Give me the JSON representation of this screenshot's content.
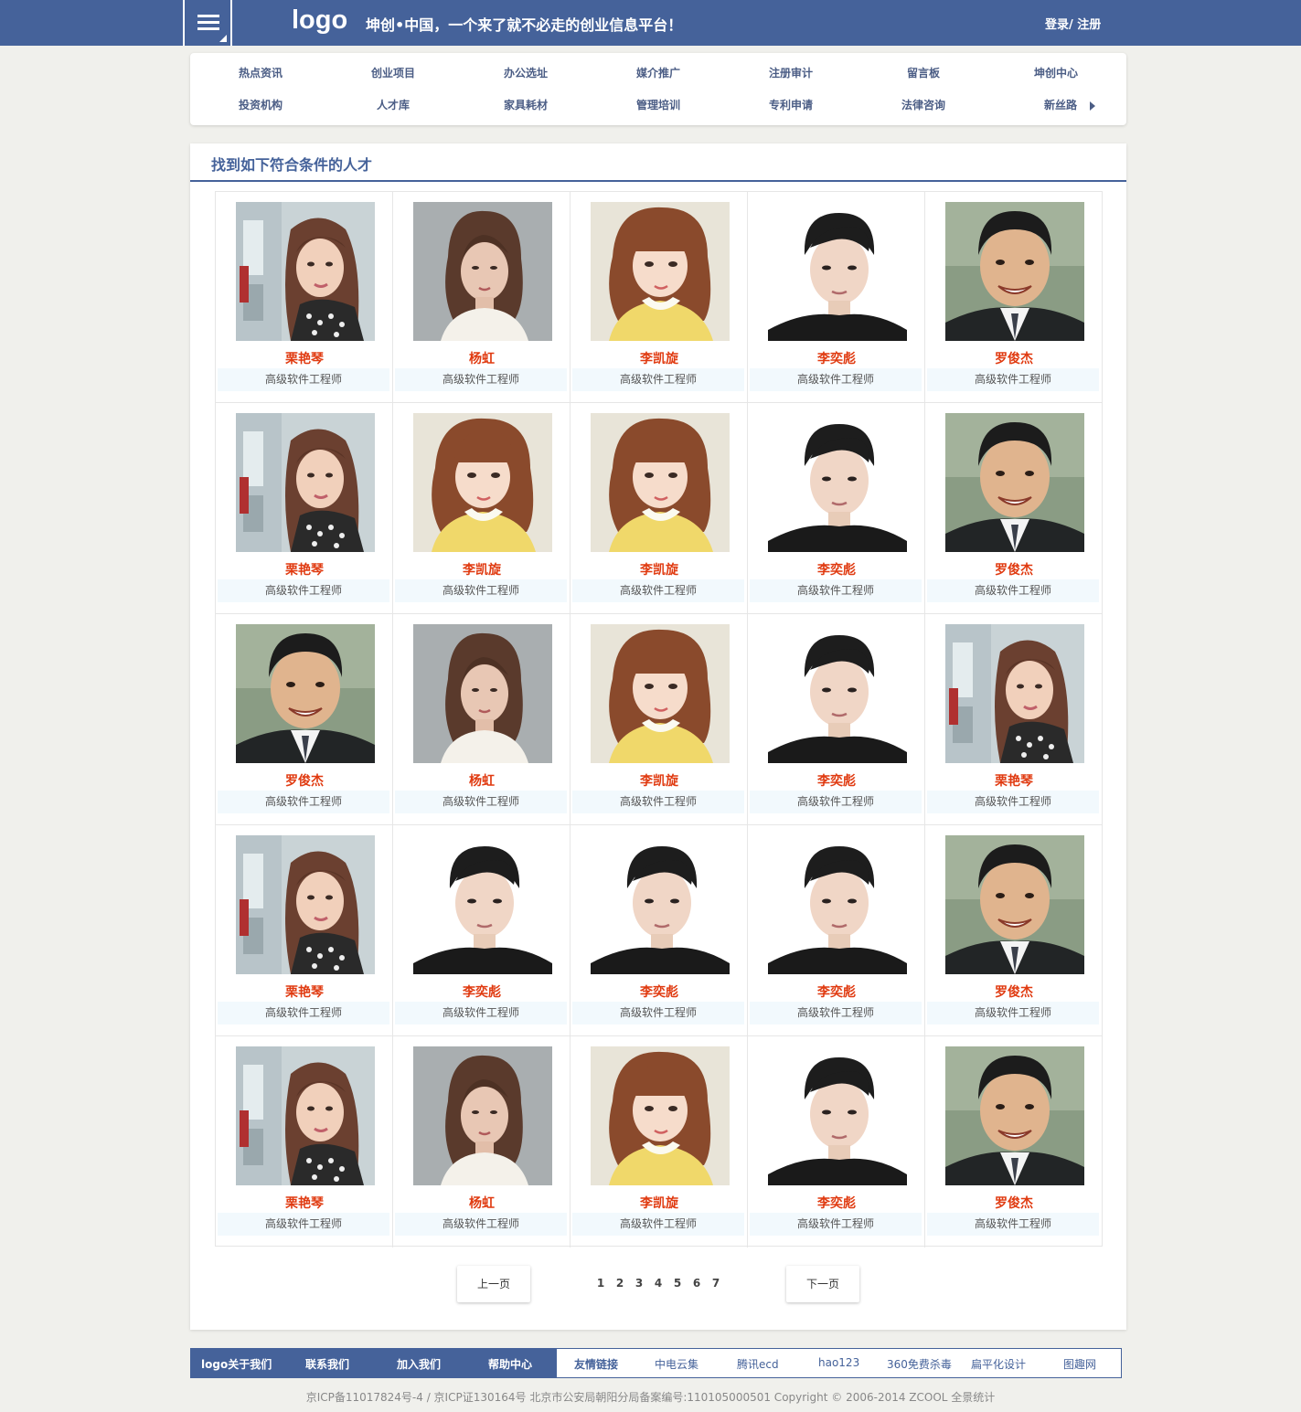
{
  "header": {
    "logo": "logo",
    "slogan": "坤创•中国，一个来了就不必走的创业信息平台！",
    "login": "登录/ 注册"
  },
  "nav": {
    "row1": [
      "热点资讯",
      "创业项目",
      "办公选址",
      "媒介推广",
      "注册审计",
      "留言板",
      "坤创中心"
    ],
    "row2": [
      "投资机构",
      "人才库",
      "家具耗材",
      "管理培训",
      "专利申请",
      "法律咨询",
      "新丝路"
    ]
  },
  "main": {
    "title": "找到如下符合条件的人才"
  },
  "people": [
    {
      "name": "栗艳琴",
      "title": "高级软件工程师",
      "photo": "woman-long-hair"
    },
    {
      "name": "杨虹",
      "title": "高级软件工程师",
      "photo": "woman-short-hair"
    },
    {
      "name": "李凯旋",
      "title": "高级软件工程师",
      "photo": "woman-bangs-yellow"
    },
    {
      "name": "李奕彪",
      "title": "高级软件工程师",
      "photo": "young-man-black-shirt"
    },
    {
      "name": "罗俊杰",
      "title": "高级软件工程师",
      "photo": "man-suit-smiling"
    },
    {
      "name": "栗艳琴",
      "title": "高级软件工程师",
      "photo": "woman-long-hair"
    },
    {
      "name": "李凯旋",
      "title": "高级软件工程师",
      "photo": "woman-bangs-yellow"
    },
    {
      "name": "李凯旋",
      "title": "高级软件工程师",
      "photo": "woman-bangs-yellow"
    },
    {
      "name": "李奕彪",
      "title": "高级软件工程师",
      "photo": "young-man-black-shirt"
    },
    {
      "name": "罗俊杰",
      "title": "高级软件工程师",
      "photo": "man-suit-smiling"
    },
    {
      "name": "罗俊杰",
      "title": "高级软件工程师",
      "photo": "man-suit-smiling"
    },
    {
      "name": "杨虹",
      "title": "高级软件工程师",
      "photo": "woman-short-hair"
    },
    {
      "name": "李凯旋",
      "title": "高级软件工程师",
      "photo": "woman-bangs-yellow"
    },
    {
      "name": "李奕彪",
      "title": "高级软件工程师",
      "photo": "young-man-black-shirt"
    },
    {
      "name": "栗艳琴",
      "title": "高级软件工程师",
      "photo": "woman-long-hair"
    },
    {
      "name": "栗艳琴",
      "title": "高级软件工程师",
      "photo": "woman-long-hair"
    },
    {
      "name": "李奕彪",
      "title": "高级软件工程师",
      "photo": "young-man-black-shirt"
    },
    {
      "name": "李奕彪",
      "title": "高级软件工程师",
      "photo": "young-man-black-shirt"
    },
    {
      "name": "李奕彪",
      "title": "高级软件工程师",
      "photo": "young-man-black-shirt"
    },
    {
      "name": "罗俊杰",
      "title": "高级软件工程师",
      "photo": "man-suit-smiling"
    },
    {
      "name": "栗艳琴",
      "title": "高级软件工程师",
      "photo": "woman-long-hair"
    },
    {
      "name": "杨虹",
      "title": "高级软件工程师",
      "photo": "woman-short-hair"
    },
    {
      "name": "李凯旋",
      "title": "高级软件工程师",
      "photo": "woman-bangs-yellow"
    },
    {
      "name": "李奕彪",
      "title": "高级软件工程师",
      "photo": "young-man-black-shirt"
    },
    {
      "name": "罗俊杰",
      "title": "高级软件工程师",
      "photo": "man-suit-smiling"
    }
  ],
  "pagination": {
    "prev": "上一页",
    "next": "下一页",
    "pages": [
      "1",
      "2",
      "3",
      "4",
      "5",
      "6",
      "7"
    ],
    "current": "1"
  },
  "footer": {
    "left_links": [
      "logo关于我们",
      "联系我们",
      "加入我们",
      "帮助中心"
    ],
    "friend_label": "友情链接",
    "friend_links": [
      "中电云集",
      "腾讯ecd",
      "hao123",
      "360免费杀毒",
      "扁平化设计",
      "图趣网"
    ],
    "copyright": "京ICP备11017824号-4 / 京ICP证130164号 北京市公安局朝阳分局备案编号:110105000501 Copyright © 2006-2014 ZCOOL 全景统计"
  },
  "colors": {
    "brand": "#45629a",
    "name_red": "#e03a10",
    "title_bg": "#f2f9fd",
    "page_bg": "#f0f0ec"
  }
}
